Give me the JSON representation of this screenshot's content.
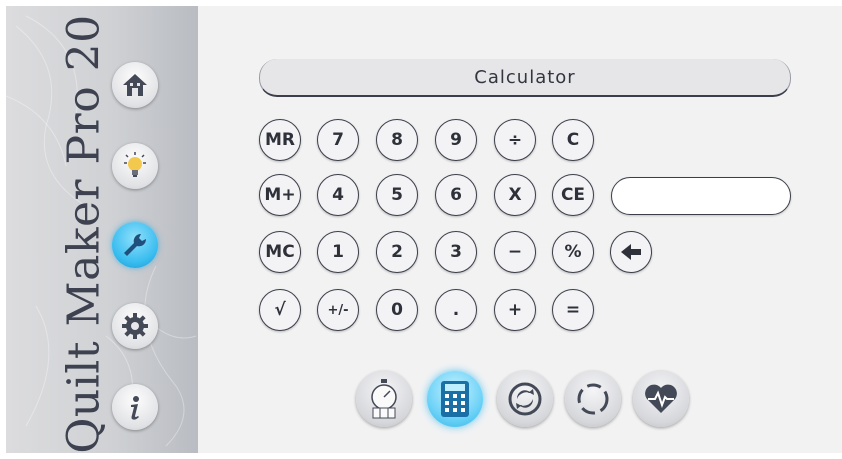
{
  "app": {
    "brand": "Quilt Maker Pro 20"
  },
  "sidebar": {
    "items": [
      {
        "name": "home",
        "icon": "home-icon",
        "active": false
      },
      {
        "name": "tips",
        "icon": "lightbulb-icon",
        "active": false
      },
      {
        "name": "tools",
        "icon": "wrench-icon",
        "active": true
      },
      {
        "name": "settings",
        "icon": "gear-icon",
        "active": false
      },
      {
        "name": "info",
        "icon": "info-icon",
        "active": false
      }
    ]
  },
  "calculator": {
    "title": "Calculator",
    "display_value": "",
    "keys": {
      "mr": "MR",
      "seven": "7",
      "eight": "8",
      "nine": "9",
      "divide": "÷",
      "clear": "C",
      "mplus": "M+",
      "four": "4",
      "five": "5",
      "six": "6",
      "multiply": "X",
      "clear_entry": "CE",
      "mc": "MC",
      "one": "1",
      "two": "2",
      "three": "3",
      "minus": "−",
      "percent": "%",
      "sqrt": "√",
      "plusminus": "+/-",
      "zero": "0",
      "decimal": ".",
      "plus": "+",
      "equals": "="
    }
  },
  "tools": [
    {
      "name": "timer",
      "icon": "stopwatch-icon",
      "active": false
    },
    {
      "name": "calculator",
      "icon": "calculator-icon",
      "active": true
    },
    {
      "name": "sync",
      "icon": "sync-icon",
      "active": false
    },
    {
      "name": "progress",
      "icon": "dashed-circle-icon",
      "active": false
    },
    {
      "name": "health",
      "icon": "heart-pulse-icon",
      "active": false
    }
  ],
  "colors": {
    "accent": "#38bcef",
    "text": "#2e313a",
    "sidebar": "#cfd1d4"
  }
}
